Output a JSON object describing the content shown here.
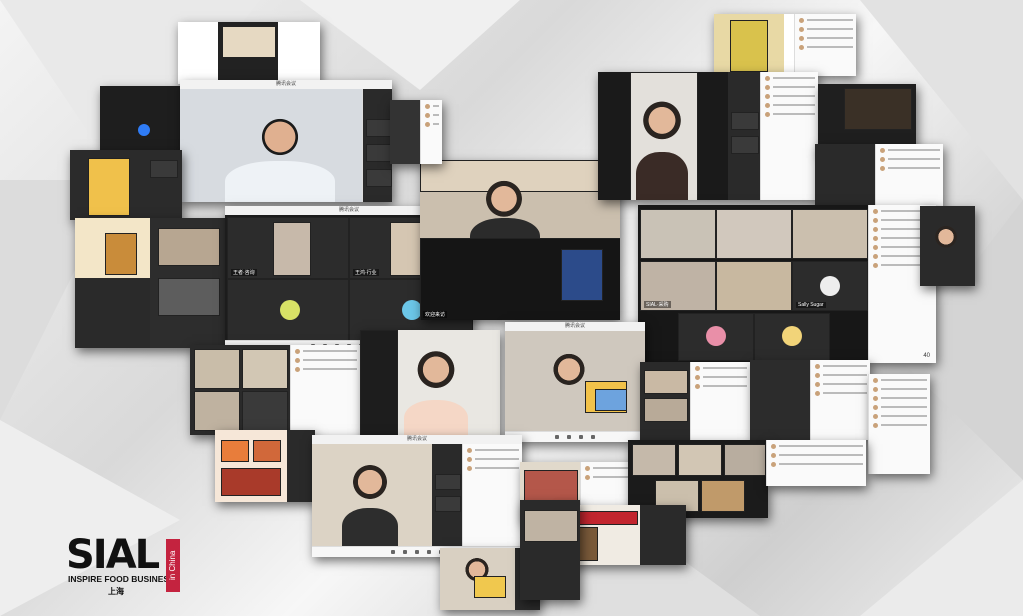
{
  "logo": {
    "brand": "SIAL",
    "tagline": "INSPIRE FOOD BUSINESS",
    "location": "in China",
    "city": "上海"
  },
  "colors": {
    "brand_red": "#c4233f",
    "meeting_dark": "#2b2b2b",
    "window_bg": "#ffffff"
  },
  "screens": {
    "main_window_title": "腾讯会议",
    "label_a": "王者·咨询",
    "label_b": "欢迎来访",
    "label_c": "王鸿·行业",
    "label_d": "SIAL·采购",
    "label_e": "Sally Sugar",
    "badge_count": "40",
    "icons": [
      "mic-icon",
      "camera-icon",
      "share-icon",
      "participants-icon",
      "chat-icon",
      "record-icon",
      "settings-icon"
    ]
  }
}
